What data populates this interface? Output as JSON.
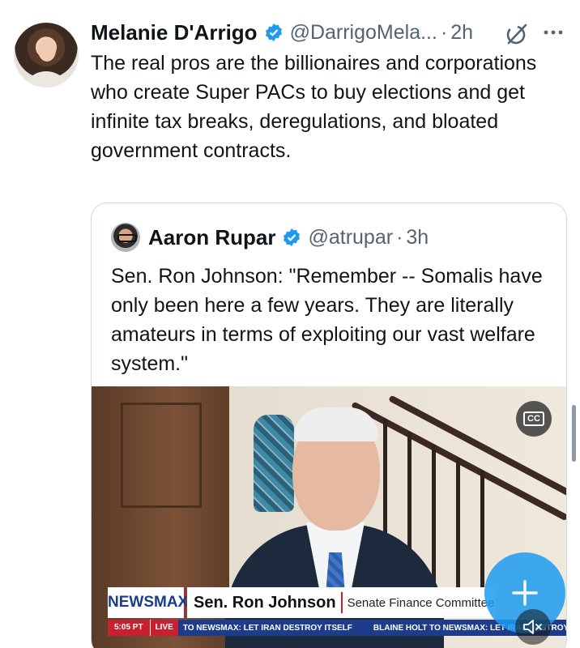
{
  "tweet": {
    "author_name": "Melanie D'Arrigo",
    "handle": "@DarrigoMela...",
    "separator": "·",
    "time": "2h",
    "text": "The real pros are the billionaires and corporations who create Super PACs to buy elections and get infinite tax breaks, deregulations, and bloated government contracts."
  },
  "quoted_tweet": {
    "author_name": "Aaron Rupar",
    "handle": "@atrupar",
    "separator": "·",
    "time": "3h",
    "text": "Sen. Ron Johnson: \"Remember -- Somalis have only been here a few years. They are literally amateurs in terms of exploiting our vast welfare system.\""
  },
  "video": {
    "cc_label": "CC",
    "network": "NEWSMAX",
    "lower_third_name": "Sen. Ron Johnson",
    "lower_third_title": "Senate Finance Committee",
    "ticker_time": "5:05 PT",
    "ticker_live": "LIVE",
    "ticker_item_1": "TO NEWSMAX: LET IRAN DESTROY ITSELF",
    "ticker_item_2": "BLAINE HOLT TO NEWSMAX: LET IRAN DESTROY"
  },
  "icons": {
    "verified": "verified-badge-icon",
    "grok": "grok-icon",
    "more": "more-icon",
    "compose": "plus-icon",
    "mute": "speaker-muted-icon"
  },
  "colors": {
    "verified_blue": "#1d9bf0",
    "secondary_text": "#536471",
    "newsmax_blue": "#1d3c8a",
    "newsmax_red": "#c8202f"
  }
}
